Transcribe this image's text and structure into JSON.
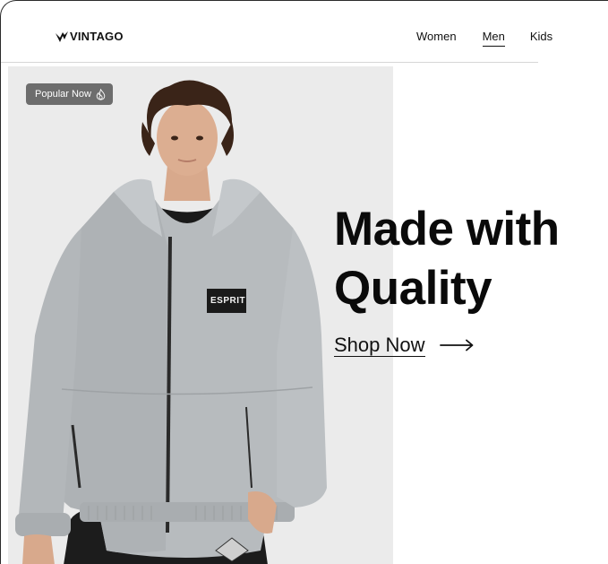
{
  "brand": {
    "name": "VINTAGO",
    "logo_icon": "vintago-logo-mark"
  },
  "nav": {
    "items": [
      {
        "label": "Women",
        "active": false
      },
      {
        "label": "Men",
        "active": true
      },
      {
        "label": "Kids",
        "active": false
      }
    ]
  },
  "hero": {
    "badge": {
      "label": "Popular Now",
      "icon": "flame-icon",
      "background": "#6d6d6d"
    },
    "headline_line1": "Made with",
    "headline_line2": "Quality",
    "cta_label": "Shop Now",
    "cta_icon": "arrow-right-icon",
    "image_label": "ESPRIT"
  },
  "colors": {
    "text": "#111111",
    "divider": "#d6d6d6",
    "image_background": "#ececec"
  }
}
